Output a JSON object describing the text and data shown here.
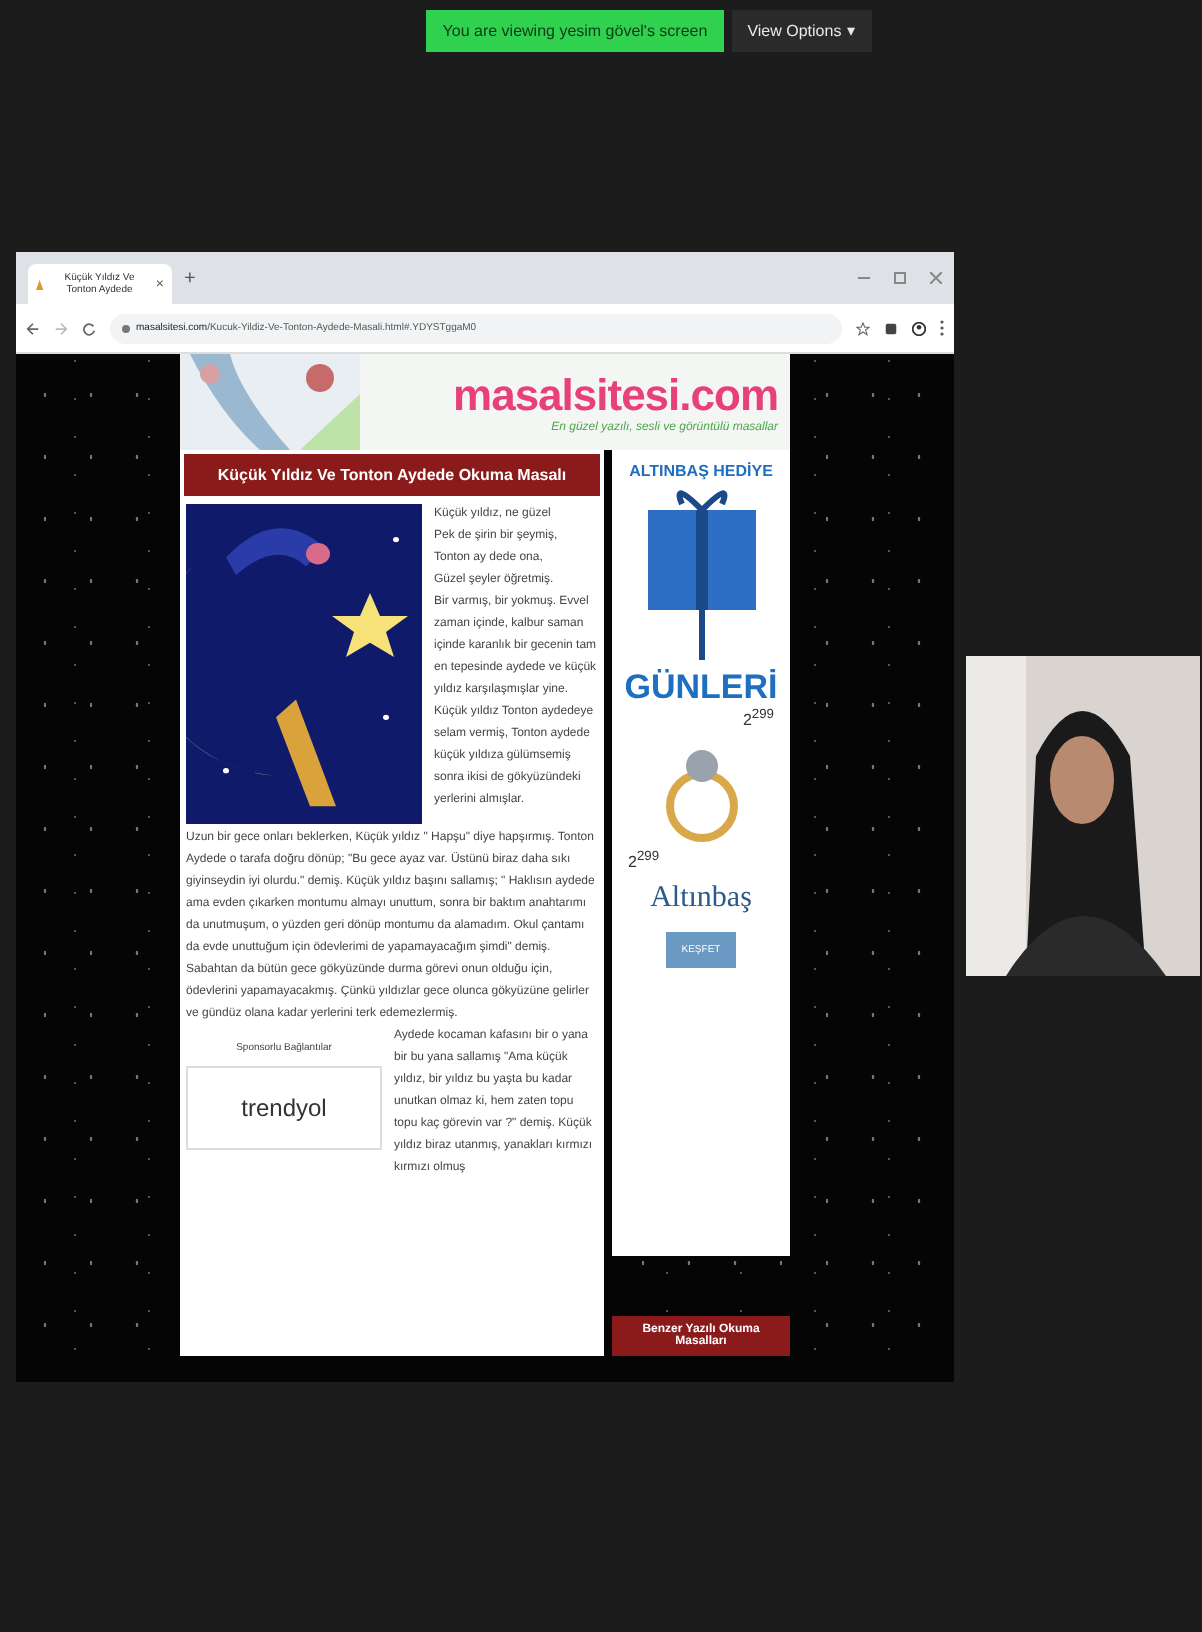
{
  "meeting": {
    "banner": "You are viewing yesim gövel's screen",
    "view_options": "View Options",
    "view_options_caret": "▾"
  },
  "browser": {
    "tabs": [
      {
        "title": "Küçük Yıldız Ve Tonton Aydede",
        "close": "×",
        "selected": true
      }
    ],
    "new_tab": "+",
    "url_domain": "masalsitesi.com",
    "url_path": "/Kucuk-Yildiz-Ve-Tonton-Aydede-Masali.html#.YDYSTggaM0"
  },
  "page": {
    "site_logo": "masalsitesi.com",
    "tagline": "En güzel yazılı, sesli ve görüntülü masallar",
    "article": {
      "title": "Küçük Yıldız Ve Tonton Aydede Okuma Masalı",
      "paragraphs": [
        "Küçük yıldız, ne güzel",
        "Pek de şirin bir şeymiş,",
        "Tonton ay dede ona,",
        "Güzel şeyler öğretmiş.",
        "Bir varmış, bir yokmuş. Evvel zaman içinde, kalbur saman içinde karanlık bir gecenin tam en tepesinde aydede ve küçük yıldız karşılaşmışlar yine. Küçük yıldız Tonton aydedeye selam vermiş, Tonton aydede küçük yıldıza gülümsemiş sonra ikisi de gökyüzündeki yerlerini almışlar.",
        "Uzun bir gece onları beklerken, Küçük yıldız \" Hapşu\" diye hapşırmış. Tonton Aydede o tarafa doğru dönüp; \"Bu gece ayaz var. Üstünü biraz daha sıkı giyinseydin iyi olurdu.\" demiş. Küçük yıldız başını sallamış; \" Haklısın aydede ama evden çıkarken montumu almayı unuttum, sonra bir baktım anahtarımı da unutmuşum, o yüzden geri dönüp montumu da alamadım. Okul çantamı da evde unuttuğum için ödevlerimi de yapamayacağım şimdi\" demiş. Sabahtan da bütün gece gökyüzünde durma görevi onun olduğu için, ödevlerini yapamayacakmış. Çünkü yıldızlar gece olunca gökyüzüne gelirler ve gündüz olana kadar yerlerini terk edemezlermiş.",
        "Aydede kocaman kafasını bir o yana bir bu yana sallamış \"Ama küçük yıldız, bir yıldız bu yaşta bu kadar unutkan olmaz ki, hem zaten topu topu kaç görevin var ?\" demiş. Küçük yıldız biraz utanmış, yanakları kırmızı kırmızı olmuş"
      ]
    },
    "sponsored": {
      "label": "Sponsorlu Bağlantılar",
      "brand": "trendyol"
    },
    "ad": {
      "headline": "ALTINBAŞ HEDİYE",
      "subhead": "GÜNLERİ",
      "prices": [
        "2$^{299}$",
        "2$^{299}$"
      ],
      "brand": "Altınbaş",
      "button": "KEŞFET"
    },
    "related_title": "Benzer Yazılı Okuma Masalları"
  }
}
